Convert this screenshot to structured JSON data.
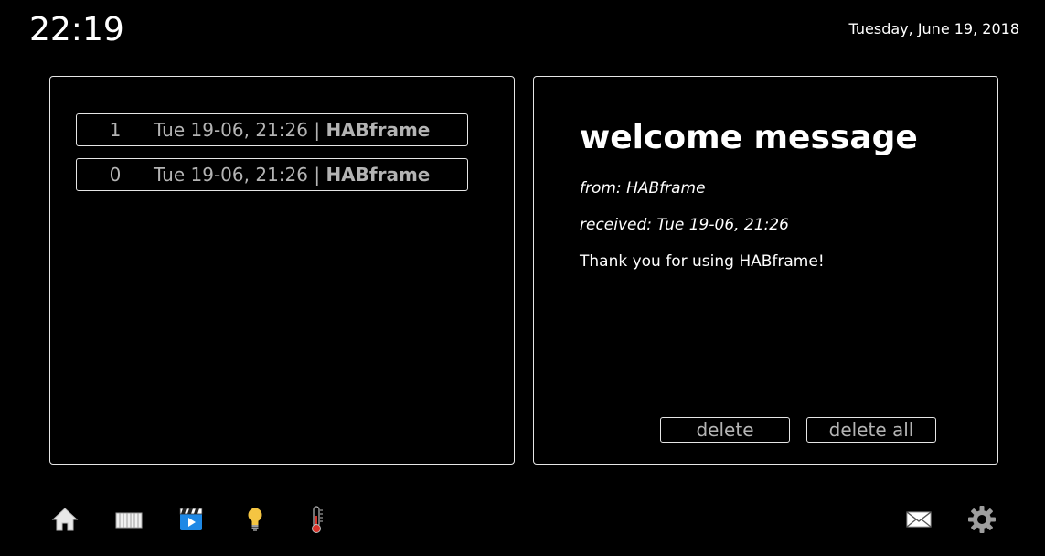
{
  "header": {
    "time": "22:19",
    "date": "Tuesday, June 19, 2018"
  },
  "messages": [
    {
      "index": "1",
      "date": "Tue 19-06, 21:26",
      "separator": " | ",
      "sender": "HABframe"
    },
    {
      "index": "0",
      "date": "Tue 19-06, 21:26",
      "separator": " | ",
      "sender": "HABframe"
    }
  ],
  "detail": {
    "title": "welcome message",
    "from": "from: HABframe",
    "received": "received: Tue 19-06, 21:26",
    "body": "Thank you for using HABframe!"
  },
  "actions": {
    "delete_label": "delete",
    "delete_all_label": "delete all"
  },
  "nav": {
    "left_icons": [
      "home-icon",
      "radiator-icon",
      "media-icon",
      "light-bulb-icon",
      "thermometer-icon"
    ],
    "right_icons": [
      "mail-icon",
      "settings-icon"
    ]
  },
  "colors": {
    "background": "#000000",
    "text": "#ffffff",
    "muted_text": "#b4b4b4",
    "border": "#e6e6e6",
    "media_icon": "#1e88e5",
    "bulb_icon": "#f5c542",
    "thermometer_red": "#d9342b"
  }
}
